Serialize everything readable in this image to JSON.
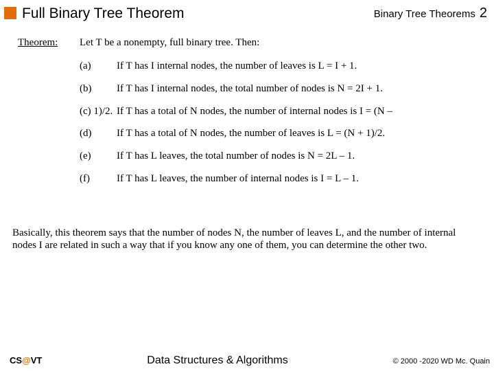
{
  "header": {
    "title_left": "Full Binary Tree Theorem",
    "title_right": "Binary Tree Theorems",
    "page_number": "2"
  },
  "theorem": {
    "label": "Theorem:",
    "intro": "Let T be a nonempty, full binary tree. Then:",
    "items": [
      {
        "label": "(a)",
        "text": "If T has I internal nodes, the number of leaves is L = I + 1."
      },
      {
        "label": "(b)",
        "text": "If T has I internal nodes, the total number of nodes is N = 2I + 1."
      },
      {
        "label": "(c) 1)/2.",
        "text": "If T has a total of N nodes, the number of internal nodes is I = (N –"
      },
      {
        "label": "(d)",
        "text": "If T has a total of N nodes, the number of leaves is L = (N + 1)/2."
      },
      {
        "label": "(e)",
        "text": "If T has L leaves, the total number of nodes is N = 2L – 1."
      },
      {
        "label": "(f)",
        "text": "If T has L leaves, the number of internal nodes is I = L – 1."
      }
    ]
  },
  "summary": "Basically, this theorem says that the number of nodes N, the number of leaves L, and the number of internal nodes I are related in such a way that if you know any one of them, you can determine the other two.",
  "footer": {
    "left_cs": "CS",
    "left_at": "@",
    "left_vt": "VT",
    "center": "Data Structures & Algorithms",
    "right": "© 2000 -2020 WD Mc. Quain"
  }
}
